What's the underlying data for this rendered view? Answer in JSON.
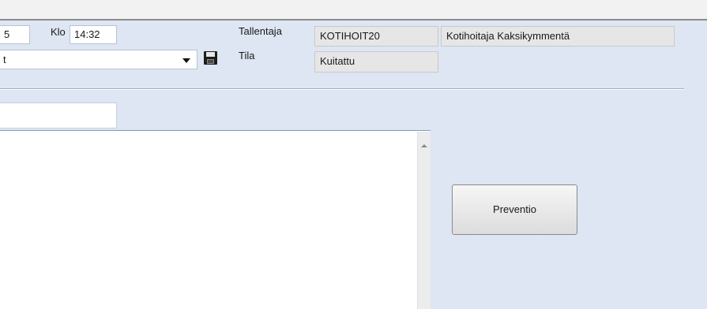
{
  "header": {
    "date_fragment": "5",
    "time_label": "Klo",
    "time_value": "14:32",
    "recorder_label": "Tallentaja",
    "recorder_code": "KOTIHOIT20",
    "recorder_name": "Kotihoitaja Kaksikymmentä",
    "status_label": "Tila",
    "status_value": "Kuitattu",
    "type_value_fragment": "t"
  },
  "icons": {
    "dropdown": "chevron-down-icon",
    "save": "save-icon",
    "scroll_up": "scroll-up-icon"
  },
  "actions": {
    "prevention_button": "Preventio"
  },
  "colors": {
    "panel_background": "#dde6f2",
    "readonly_field": "#e6e6e6",
    "top_strip": "#f2f2f2"
  }
}
